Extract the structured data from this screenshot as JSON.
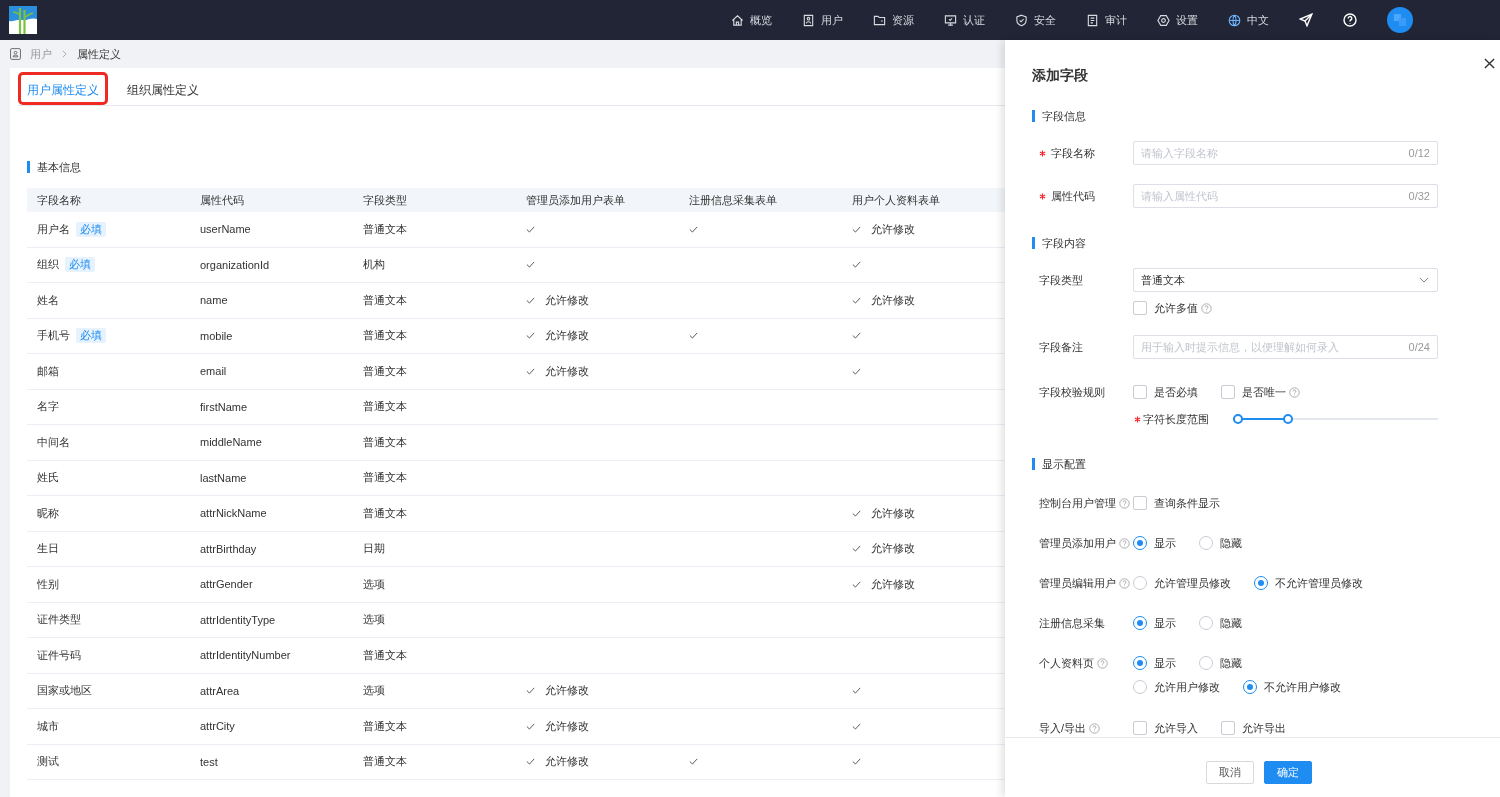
{
  "top_bar": {
    "nav": [
      {
        "label": "概览"
      },
      {
        "label": "用户"
      },
      {
        "label": "资源"
      },
      {
        "label": "认证"
      },
      {
        "label": "安全"
      },
      {
        "label": "审计"
      },
      {
        "label": "设置"
      }
    ],
    "language": "中文"
  },
  "breadcrumb": [
    {
      "label": "用户"
    },
    {
      "label": "属性定义"
    }
  ],
  "tabs": [
    {
      "label": "用户属性定义",
      "selected": true,
      "highlighted": true
    },
    {
      "label": "组织属性定义",
      "selected": false,
      "highlighted": false
    }
  ],
  "table_section": {
    "title": "基本信息"
  },
  "table": {
    "columns": [
      "字段名称",
      "属性代码",
      "字段类型",
      "管理员添加用户表单",
      "注册信息采集表单",
      "用户个人资料表单"
    ],
    "rows": [
      {
        "name": "用户名",
        "tag": "必填",
        "code": "userName",
        "type": "普通文本",
        "forms": [
          {
            "checked": true
          },
          {
            "checked": true
          },
          {
            "checked": true,
            "note": "允许修改"
          }
        ]
      },
      {
        "name": "组织",
        "tag": "必填",
        "code": "organizationId",
        "type": "机构",
        "forms": [
          {
            "checked": true
          },
          {
            "checked": false
          },
          {
            "checked": true
          }
        ]
      },
      {
        "name": "姓名",
        "code": "name",
        "type": "普通文本",
        "forms": [
          {
            "checked": true,
            "note": "允许修改"
          },
          {
            "checked": false
          },
          {
            "checked": true,
            "note": "允许修改"
          }
        ]
      },
      {
        "name": "手机号",
        "tag": "必填",
        "code": "mobile",
        "type": "普通文本",
        "forms": [
          {
            "checked": true,
            "note": "允许修改"
          },
          {
            "checked": true
          },
          {
            "checked": true
          }
        ]
      },
      {
        "name": "邮箱",
        "code": "email",
        "type": "普通文本",
        "forms": [
          {
            "checked": true,
            "note": "允许修改"
          },
          {
            "checked": false
          },
          {
            "checked": true
          }
        ]
      },
      {
        "name": "名字",
        "code": "firstName",
        "type": "普通文本",
        "forms": [
          {
            "checked": false
          },
          {
            "checked": false
          },
          {
            "checked": false
          }
        ]
      },
      {
        "name": "中间名",
        "code": "middleName",
        "type": "普通文本",
        "forms": [
          {
            "checked": false
          },
          {
            "checked": false
          },
          {
            "checked": false
          }
        ]
      },
      {
        "name": "姓氏",
        "code": "lastName",
        "type": "普通文本",
        "forms": [
          {
            "checked": false
          },
          {
            "checked": false
          },
          {
            "checked": false
          }
        ]
      },
      {
        "name": "昵称",
        "code": "attrNickName",
        "type": "普通文本",
        "forms": [
          {
            "checked": false
          },
          {
            "checked": false
          },
          {
            "checked": true,
            "note": "允许修改"
          }
        ]
      },
      {
        "name": "生日",
        "code": "attrBirthday",
        "type": "日期",
        "forms": [
          {
            "checked": false
          },
          {
            "checked": false
          },
          {
            "checked": true,
            "note": "允许修改"
          }
        ]
      },
      {
        "name": "性别",
        "code": "attrGender",
        "type": "选项",
        "forms": [
          {
            "checked": false
          },
          {
            "checked": false
          },
          {
            "checked": true,
            "note": "允许修改"
          }
        ]
      },
      {
        "name": "证件类型",
        "code": "attrIdentityType",
        "type": "选项",
        "forms": [
          {
            "checked": false
          },
          {
            "checked": false
          },
          {
            "checked": false
          }
        ]
      },
      {
        "name": "证件号码",
        "code": "attrIdentityNumber",
        "type": "普通文本",
        "forms": [
          {
            "checked": false
          },
          {
            "checked": false
          },
          {
            "checked": false
          }
        ]
      },
      {
        "name": "国家或地区",
        "code": "attrArea",
        "type": "选项",
        "forms": [
          {
            "checked": true,
            "note": "允许修改"
          },
          {
            "checked": false
          },
          {
            "checked": true
          }
        ]
      },
      {
        "name": "城市",
        "code": "attrCity",
        "type": "普通文本",
        "forms": [
          {
            "checked": true,
            "note": "允许修改"
          },
          {
            "checked": false
          },
          {
            "checked": true
          }
        ]
      },
      {
        "name": "测试",
        "code": "test",
        "type": "普通文本",
        "forms": [
          {
            "checked": true,
            "note": "允许修改"
          },
          {
            "checked": true
          },
          {
            "checked": true
          }
        ]
      }
    ]
  },
  "drawer": {
    "title": "添加字段",
    "sections": [
      {
        "title": "字段信息",
        "fields": [
          {
            "kind": "input",
            "label": "字段名称",
            "required": true,
            "help": false,
            "placeholder": "请输入字段名称",
            "counter": "0/12"
          },
          {
            "kind": "input",
            "label": "属性代码",
            "required": true,
            "help": false,
            "placeholder": "请输入属性代码",
            "counter": "0/32"
          }
        ]
      },
      {
        "title": "字段内容",
        "fields": [
          {
            "kind": "select",
            "label": "字段类型",
            "required": false,
            "help": false,
            "value": "普通文本",
            "checks": [
              {
                "label": "允许多值",
                "checked": false,
                "help": true
              }
            ]
          },
          {
            "kind": "input",
            "label": "字段备注",
            "required": false,
            "help": false,
            "placeholder": "用于输入时提示信息，以便理解如何录入",
            "counter": "0/24"
          },
          {
            "kind": "checks",
            "label": "字段校验规则",
            "required": false,
            "help": false,
            "checks": [
              {
                "label": "是否必填",
                "checked": false,
                "help": false
              },
              {
                "label": "是否唯一",
                "checked": false,
                "help": true
              }
            ],
            "range": {
              "label": "字符长度范围",
              "required": true,
              "level": 0.27
            }
          }
        ]
      },
      {
        "title": "显示配置",
        "fields": [
          {
            "kind": "checks",
            "label": "控制台用户管理",
            "required": false,
            "help": true,
            "checks": [
              {
                "label": "查询条件显示",
                "checked": false,
                "help": false
              }
            ]
          },
          {
            "kind": "radios",
            "label": "管理员添加用户",
            "required": false,
            "help": true,
            "groups": [
              {
                "options": [
                  {
                    "label": "显示",
                    "selected": true
                  },
                  {
                    "label": "隐藏",
                    "selected": false
                  }
                ]
              }
            ]
          },
          {
            "kind": "radios",
            "label": "管理员编辑用户",
            "required": false,
            "help": true,
            "groups": [
              {
                "options": [
                  {
                    "label": "允许管理员修改",
                    "selected": false
                  },
                  {
                    "label": "不允许管理员修改",
                    "selected": true
                  }
                ]
              }
            ]
          },
          {
            "kind": "radios",
            "label": "注册信息采集",
            "required": false,
            "help": false,
            "groups": [
              {
                "options": [
                  {
                    "label": "显示",
                    "selected": true
                  },
                  {
                    "label": "隐藏",
                    "selected": false
                  }
                ]
              }
            ]
          },
          {
            "kind": "radios",
            "label": "个人资料页",
            "required": false,
            "help": true,
            "groups": [
              {
                "options": [
                  {
                    "label": "显示",
                    "selected": true
                  },
                  {
                    "label": "隐藏",
                    "selected": false
                  }
                ]
              },
              {
                "options": [
                  {
                    "label": "允许用户修改",
                    "selected": false
                  },
                  {
                    "label": "不允许用户修改",
                    "selected": true
                  }
                ]
              }
            ]
          },
          {
            "kind": "checks",
            "label": "导入/导出",
            "required": false,
            "help": true,
            "checks": [
              {
                "label": "允许导入",
                "checked": false,
                "help": false
              },
              {
                "label": "允许导出",
                "checked": false,
                "help": false
              }
            ]
          }
        ]
      }
    ],
    "buttons": [
      {
        "label": "取消",
        "kind": "default"
      },
      {
        "label": "确定",
        "kind": "primary"
      }
    ]
  }
}
